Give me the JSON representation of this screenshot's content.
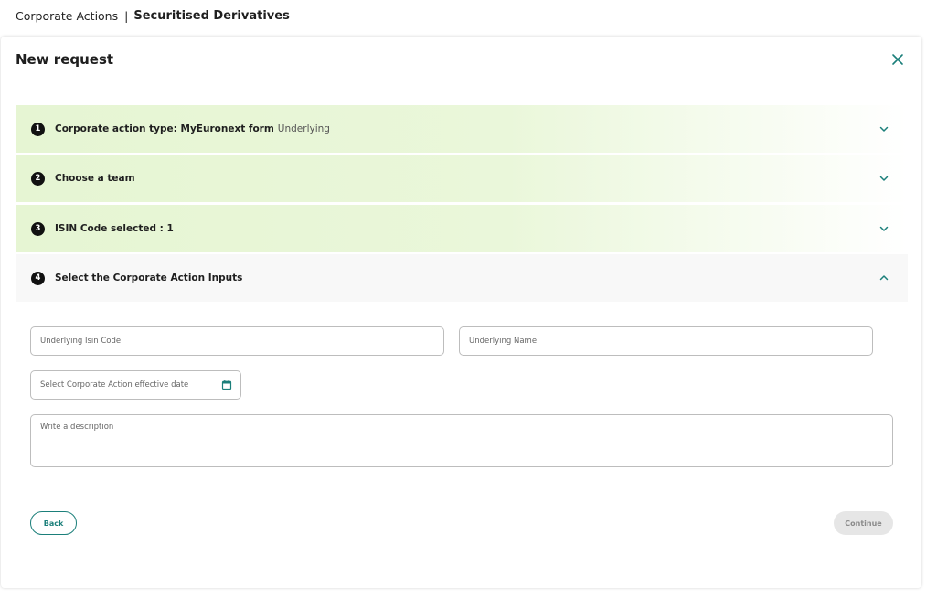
{
  "breadcrumb": {
    "parent": "Corporate Actions",
    "separator": "|",
    "current": "Securitised Derivatives"
  },
  "card": {
    "title": "New request",
    "close_icon": "close-icon"
  },
  "steps": [
    {
      "number": "1",
      "label": "Corporate action type: MyEuronext form",
      "suffix": "Underlying",
      "state": "completed",
      "icon": "chevron-down-icon"
    },
    {
      "number": "2",
      "label": "Choose a team",
      "suffix": "",
      "state": "completed",
      "icon": "chevron-down-icon"
    },
    {
      "number": "3",
      "label": "ISIN Code selected : 1",
      "suffix": "",
      "state": "completed",
      "icon": "chevron-down-icon"
    },
    {
      "number": "4",
      "label": "Select the Corporate Action Inputs",
      "suffix": "",
      "state": "open",
      "icon": "chevron-up-icon"
    }
  ],
  "form": {
    "isin_placeholder": "Underlying Isin Code",
    "isin_value": "",
    "name_placeholder": "Underlying Name",
    "name_value": "",
    "date_placeholder": "Select Corporate Action effective date",
    "date_value": "",
    "description_placeholder": "Write a description",
    "description_value": ""
  },
  "actions": {
    "back_label": "Back",
    "continue_label": "Continue"
  },
  "colors": {
    "accent": "#1b7f7a",
    "step_completed_bg": "#e6f5d3",
    "step_open_bg": "#f8f8f8",
    "disabled_bg": "#e6e6e6"
  }
}
